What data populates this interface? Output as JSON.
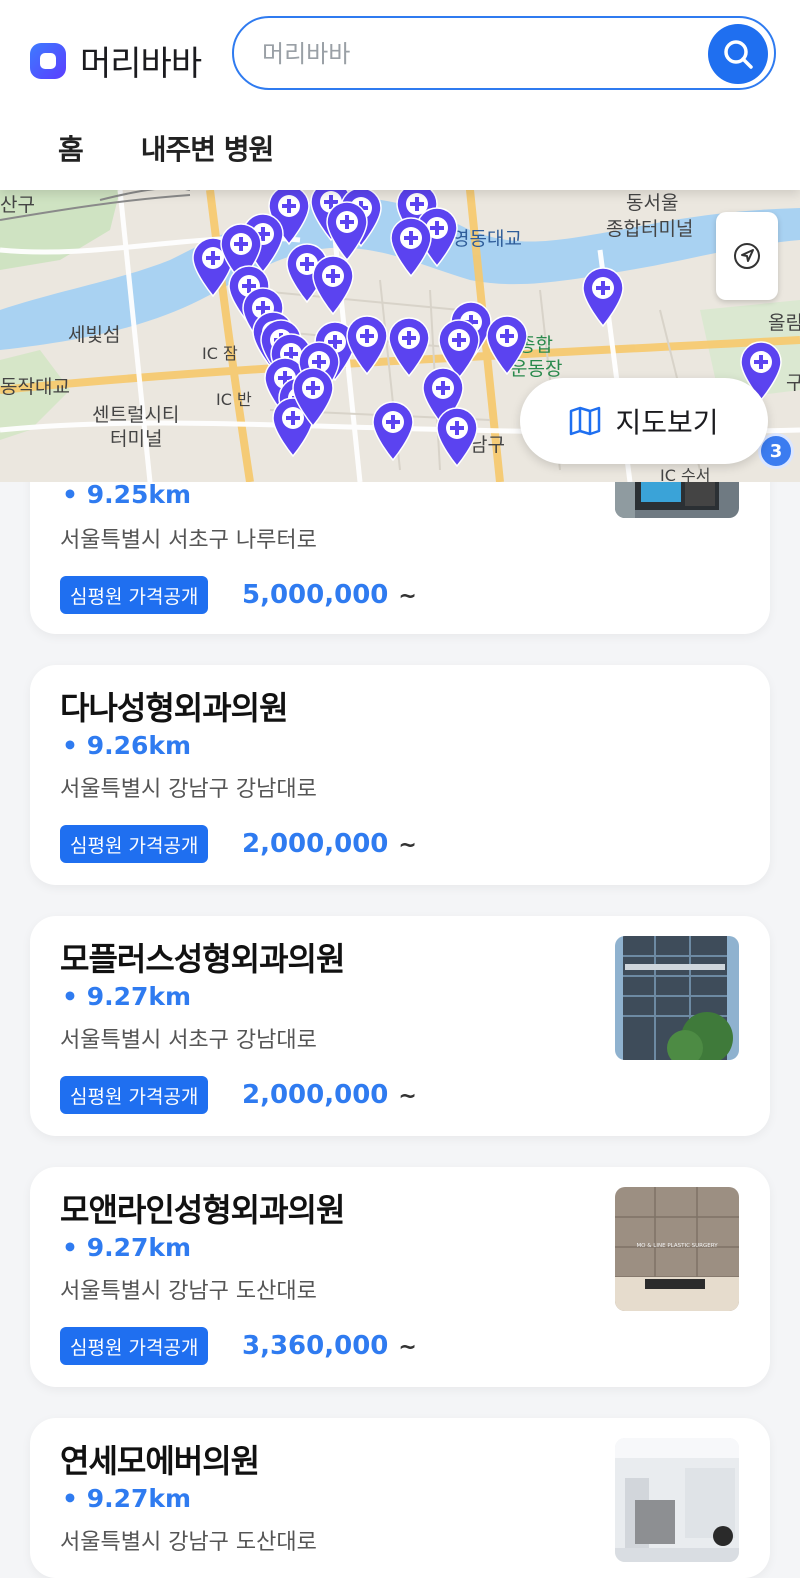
{
  "header": {
    "logo_text": "머리바바",
    "search_placeholder": "머리바바",
    "tabs": [
      {
        "label": "홈"
      },
      {
        "label": "내주변 병원"
      }
    ]
  },
  "map": {
    "labels": {
      "l1": "산구",
      "l2": "동서울",
      "l3": "종합터미널",
      "l4": "영동대교",
      "l5": "세빛섬",
      "l6": "IC 잠",
      "l7": "종합",
      "l8": "운동장",
      "l9": "올림",
      "l10": "동작대교",
      "l11": "센트럴시티",
      "l12": "터미널",
      "l13": "IC 반",
      "l14": "남구",
      "l15": "IC 수서",
      "l16": "구"
    },
    "map_view_button": "지도보기",
    "cluster_count": "3",
    "pin_color": "#5b43f0"
  },
  "hospitals": [
    {
      "name": "",
      "distance": "9.25km",
      "address": "서울특별시 서초구 나루터로",
      "badge": "심평원 가격공개",
      "price": "5,000,000",
      "tilde": "~"
    },
    {
      "name": "다나성형외과의원",
      "distance": "9.26km",
      "address": "서울특별시 강남구 강남대로",
      "badge": "심평원 가격공개",
      "price": "2,000,000",
      "tilde": "~"
    },
    {
      "name": "모플러스성형외과의원",
      "distance": "9.27km",
      "address": "서울특별시 서초구 강남대로",
      "badge": "심평원 가격공개",
      "price": "2,000,000",
      "tilde": "~"
    },
    {
      "name": "모앤라인성형외과의원",
      "distance": "9.27km",
      "address": "서울특별시 강남구 도산대로",
      "badge": "심평원 가격공개",
      "price": "3,360,000",
      "tilde": "~",
      "sign_text": "MO & LINE PLASTIC SURGERY"
    },
    {
      "name": "연세모에버의원",
      "distance": "9.27km",
      "address": "서울특별시 강남구 도산대로"
    }
  ],
  "colors": {
    "accent": "#2f7bf0",
    "badge_bg": "#1f6ff0",
    "pin": "#5b43f0"
  }
}
